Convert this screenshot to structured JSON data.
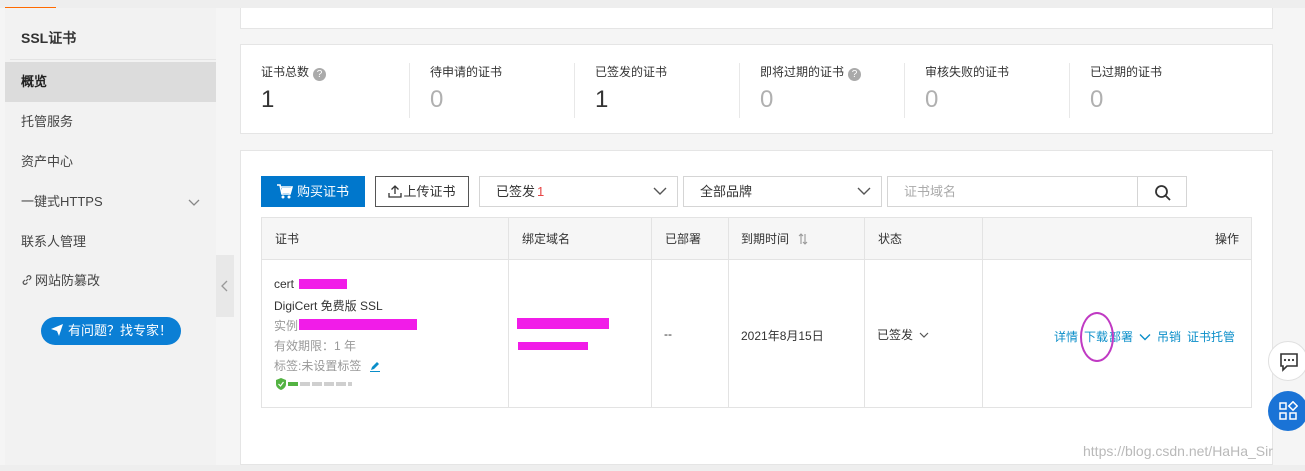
{
  "sidebar": {
    "title": "SSL证书",
    "items": [
      {
        "label": "概览"
      },
      {
        "label": "托管服务"
      },
      {
        "label": "资产中心"
      },
      {
        "label": "一键式HTTPS"
      },
      {
        "label": "联系人管理"
      },
      {
        "label": "网站防篡改"
      }
    ],
    "help_button": "有问题？找专家！"
  },
  "stats": [
    {
      "label": "证书总数",
      "value": "1"
    },
    {
      "label": "待申请的证书",
      "value": "0"
    },
    {
      "label": "已签发的证书",
      "value": "1"
    },
    {
      "label": "即将过期的证书",
      "value": "0"
    },
    {
      "label": "审核失败的证书",
      "value": "0"
    },
    {
      "label": "已过期的证书",
      "value": "0"
    }
  ],
  "toolbar": {
    "buy_label": "购买证书",
    "upload_label": "上传证书",
    "status_filter": "已签发",
    "status_count": "1",
    "brand_filter": "全部品牌",
    "search_placeholder": "证书域名"
  },
  "table": {
    "columns": [
      "证书",
      "绑定域名",
      "已部署",
      "到期时间",
      "状态",
      "操作"
    ],
    "row": {
      "cert_name_prefix": "cert",
      "product": "DigiCert 免费版 SSL",
      "instance_label": "实例",
      "validity": "有效期限：1 年",
      "tag": "标签:未设置标签",
      "deployed": "--",
      "expiry": "2021年8月15日",
      "status": "已签发",
      "actions": {
        "detail": "详情",
        "download": "下载",
        "deploy": "部署",
        "revoke": "吊销",
        "hosting": "证书托管"
      }
    }
  },
  "watermark": "https://blog.csdn.net/HaHa_Sir",
  "colors": {
    "accent": "#0077cc",
    "link": "#0a8ec9",
    "redaction": "#f11ce8",
    "annotation": "#c03ac3"
  }
}
